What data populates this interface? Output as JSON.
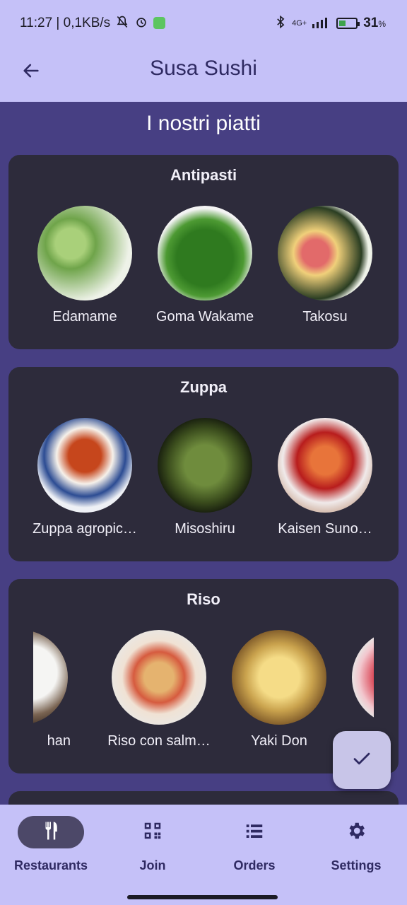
{
  "status_bar": {
    "time_info": "11:27 | 0,1KB/s",
    "network": "4G+",
    "battery": "31",
    "battery_unit": "%",
    "icons": [
      "mute-bell-icon",
      "alarm-icon",
      "app-icon",
      "bluetooth-icon",
      "signal-icon",
      "battery-icon"
    ]
  },
  "app_bar": {
    "title": "Susa Sushi",
    "back_icon": "arrow-back-icon"
  },
  "section_title": "I nostri piatti",
  "categories": [
    {
      "title": "Antipasti",
      "dishes": [
        {
          "name": "Edamame"
        },
        {
          "name": "Goma Wakame"
        },
        {
          "name": "Takosu"
        }
      ]
    },
    {
      "title": "Zuppa",
      "dishes": [
        {
          "name": "Zuppa agropic…"
        },
        {
          "name": "Misoshiru"
        },
        {
          "name": "Kaisen Suno…"
        }
      ]
    },
    {
      "title": "Riso",
      "dishes": [
        {
          "name": "han"
        },
        {
          "name": "Riso con salm…"
        },
        {
          "name": "Yaki Don"
        },
        {
          "name": ""
        }
      ]
    }
  ],
  "fab": {
    "icon": "check-icon"
  },
  "bottom_nav": {
    "items": [
      {
        "label": "Restaurants",
        "icon": "fork-knife-icon",
        "active": true
      },
      {
        "label": "Join",
        "icon": "qr-code-icon",
        "active": false
      },
      {
        "label": "Orders",
        "icon": "list-icon",
        "active": false
      },
      {
        "label": "Settings",
        "icon": "gear-icon",
        "active": false
      }
    ]
  },
  "colors": {
    "accent": "#c5c1f8",
    "background": "#473f83",
    "card": "#2d2b3b",
    "fab": "#c8c5e8",
    "nav_active": "#4c4868"
  }
}
